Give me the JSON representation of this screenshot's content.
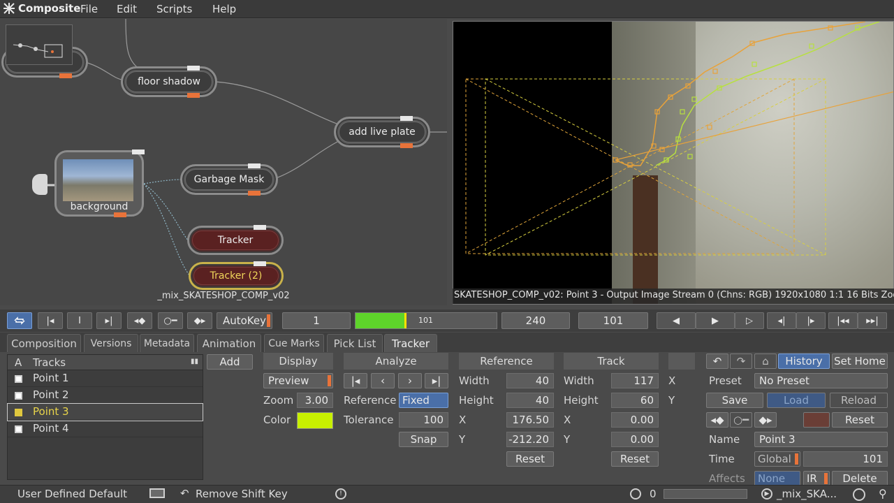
{
  "menubar": {
    "app_title": "Composite",
    "items": [
      "File",
      "Edit",
      "Scripts",
      "Help"
    ]
  },
  "nodegraph": {
    "nodes": {
      "floor_shadow": "floor shadow",
      "add_live_plate": "add live plate",
      "garbage_mask": "Garbage Mask",
      "background": "background",
      "tracker": "Tracker",
      "tracker2": "Tracker (2)"
    },
    "caption": "_mix_SKATESHOP_COMP_v02"
  },
  "viewer": {
    "caption": "SKATESHOP_COMP_v02: Point 3 - Output Image  Stream 0 (Chns: RGB)  1920x1080  1:1  16 Bits  Zoom"
  },
  "transport": {
    "autokey_label": "AutoKey",
    "start_frame": "1",
    "current_marker": "101",
    "end_frame": "240",
    "current_frame": "101",
    "progress": 0.35
  },
  "tabs": [
    "Composition",
    "Versions",
    "Metadata",
    "Animation",
    "Cue Marks",
    "Pick List",
    "Tracker"
  ],
  "active_tab": "Tracker",
  "tracks": {
    "col_a": "A",
    "col_tracks": "Tracks",
    "items": [
      "Point 1",
      "Point 2",
      "Point 3",
      "Point 4"
    ],
    "selected": "Point 3",
    "add_label": "Add"
  },
  "display": {
    "header": "Display",
    "mode": "Preview",
    "zoom_label": "Zoom",
    "zoom_value": "3.00",
    "color_label": "Color",
    "color_value": "#c8f000"
  },
  "analyze": {
    "header": "Analyze",
    "reference_label": "Reference",
    "reference_value": "Fixed",
    "tolerance_label": "Tolerance",
    "tolerance_value": "100",
    "snap_label": "Snap"
  },
  "reference": {
    "header": "Reference",
    "width_label": "Width",
    "width_value": "40",
    "height_label": "Height",
    "height_value": "40",
    "x_label": "X",
    "x_value": "176.50",
    "y_label": "Y",
    "y_value": "-212.20",
    "reset_label": "Reset"
  },
  "track": {
    "header": "Track",
    "width_label": "Width",
    "width_value": "117",
    "height_label": "Height",
    "height_value": "60",
    "x_label": "X",
    "x_value": "0.00",
    "y_label": "Y",
    "y_value": "0.00",
    "reset_label": "Reset",
    "extra_x": "X",
    "extra_y": "Y"
  },
  "history": {
    "history_label": "History",
    "set_home_label": "Set Home",
    "preset_label": "Preset",
    "preset_value": "No Preset",
    "save_label": "Save",
    "load_label": "Load",
    "reload_label": "Reload",
    "reset_label": "Reset",
    "name_label": "Name",
    "name_value": "Point 3",
    "time_label": "Time",
    "time_mode": "Global",
    "time_value": "101",
    "affects_label": "Affects",
    "affects_value": "None",
    "ir_label": "IR",
    "delete_label": "Delete"
  },
  "statusbar": {
    "default_label": "User Defined Default",
    "remove_shift_label": "Remove Shift Key",
    "counter": "0",
    "comp_name": "_mix_SKA..."
  }
}
